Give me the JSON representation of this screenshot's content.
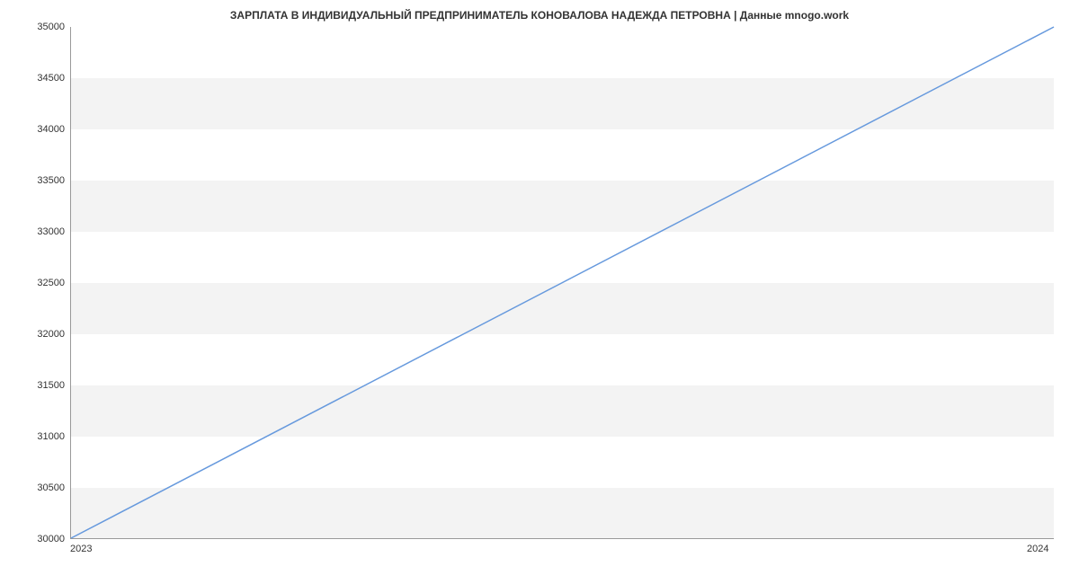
{
  "chart_data": {
    "type": "line",
    "title": "ЗАРПЛАТА В ИНДИВИДУАЛЬНЫЙ ПРЕДПРИНИМАТЕЛЬ  КОНОВАЛОВА НАДЕЖДА ПЕТРОВНА | Данные mnogo.work",
    "x": [
      2023,
      2024
    ],
    "values": [
      30000,
      35000
    ],
    "xlabel": "",
    "ylabel": "",
    "xlim": [
      2023,
      2024
    ],
    "ylim": [
      30000,
      35000
    ],
    "y_ticks": [
      30000,
      30500,
      31000,
      31500,
      32000,
      32500,
      33000,
      33500,
      34000,
      34500,
      35000
    ],
    "x_ticks": [
      2023,
      2024
    ],
    "line_color": "#6699dd"
  }
}
